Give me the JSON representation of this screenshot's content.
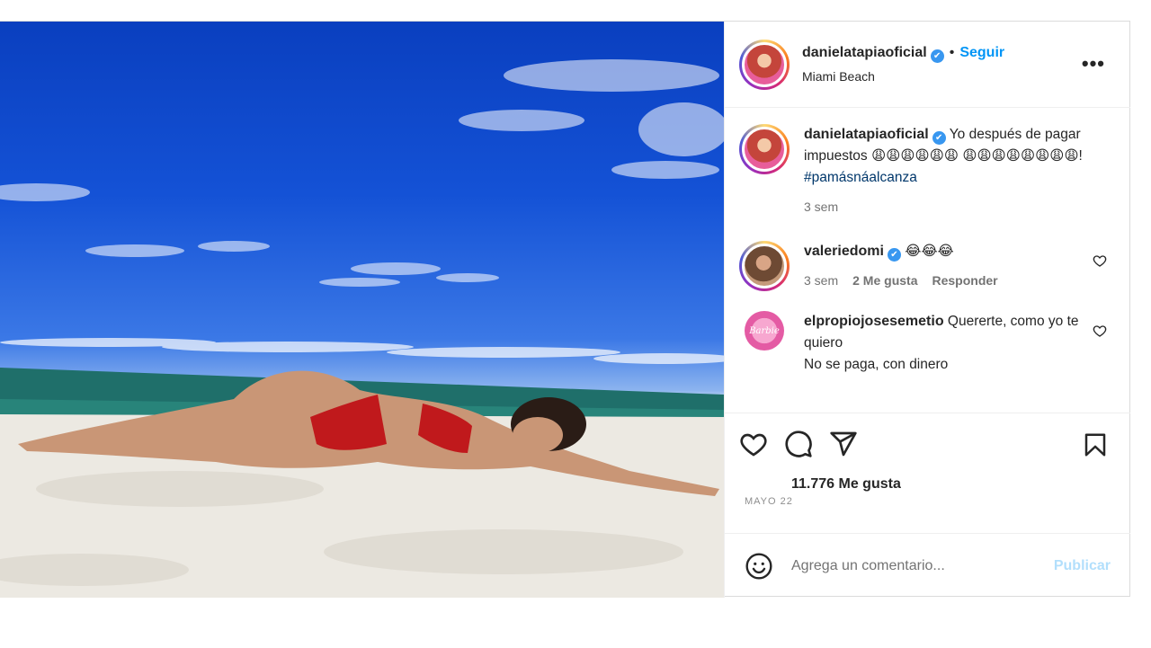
{
  "post": {
    "username": "danielatapiaoficial",
    "verified_glyph": "✔",
    "separator": "•",
    "follow_label": "Seguir",
    "location": "Miami Beach",
    "more_glyph": "•••",
    "image_icon": "beach-photo"
  },
  "caption": {
    "username": "danielatapiaoficial",
    "text": "Yo después de pagar impuestos 😩😩😩😩😩😩 😩😩😩😩😩😩😩😩!",
    "hashtag": "#pamásnáalcanza",
    "time": "3 sem"
  },
  "comments": [
    {
      "username": "valeriedomi",
      "text": "😂😂😂",
      "time": "3 sem",
      "likes": "2 Me gusta",
      "reply_label": "Responder"
    },
    {
      "username": "elpropiojosesemetio",
      "text": "Quererte, como yo te quiero",
      "text_line2": "No se paga, con dinero",
      "avatar_label": "Barbie"
    }
  ],
  "actions": {
    "likes_count": "11.776 Me gusta",
    "date": "MAYO 22"
  },
  "composer": {
    "placeholder": "Agrega un comentario...",
    "publish_label": "Publicar"
  },
  "icons": [
    "like-icon",
    "comment-icon",
    "share-icon",
    "save-icon",
    "emoji-icon",
    "more-options-icon",
    "verified-icon"
  ],
  "colors": {
    "accent": "#0095f6",
    "publish_disabled": "#b2dffc",
    "verified": "#3897f0"
  }
}
